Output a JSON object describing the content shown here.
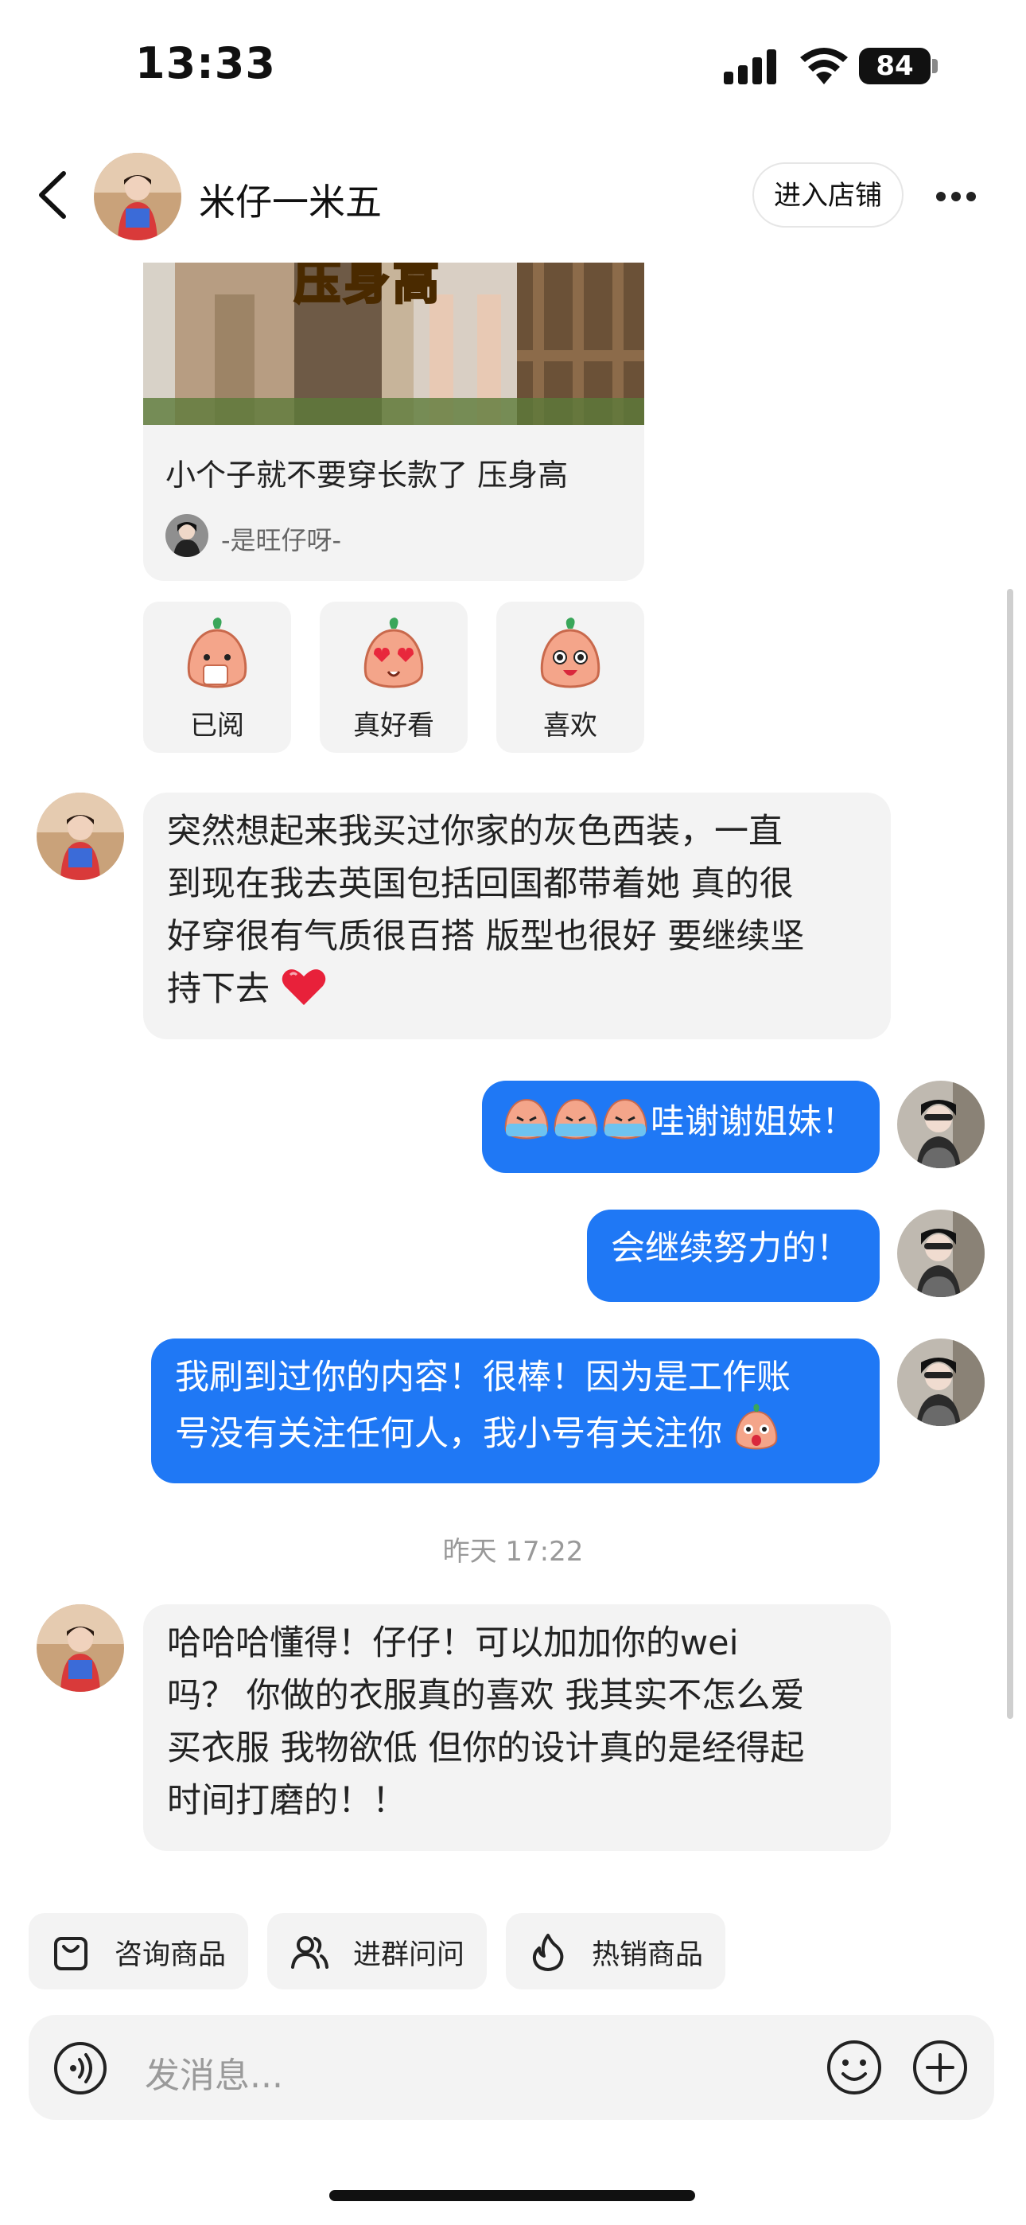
{
  "status_bar": {
    "time": "13:33",
    "battery": "84"
  },
  "header": {
    "title": "米仔一米五",
    "shop_button": "进入店铺"
  },
  "card": {
    "image_text": "压身高",
    "title": "小个子就不要穿长款了 压身高",
    "author": "-是旺仔呀-"
  },
  "reactions": [
    {
      "label": "已阅",
      "icon": "read-face-icon"
    },
    {
      "label": "真好看",
      "icon": "heart-eyes-face-icon"
    },
    {
      "label": "喜欢",
      "icon": "like-face-icon"
    }
  ],
  "messages": [
    {
      "side": "left",
      "lines": [
        "突然想起来我买过你家的灰色西装，一直",
        "到现在我去英国包括回国都带着她 真的很",
        "好穿很有气质很百搭 版型也很好 要继续坚",
        "持下去"
      ],
      "emoji": "red-heart-icon"
    },
    {
      "side": "right",
      "text": "哇谢谢姐妹！",
      "emoji_prefix": "crying-face-icon"
    },
    {
      "side": "right",
      "text": "会继续努力的！"
    },
    {
      "side": "right",
      "lines": [
        "我刷到过你的内容！很棒！因为是工作账",
        "号没有关注任何人，我小号有关注你"
      ],
      "emoji": "surprised-face-icon"
    },
    {
      "side": "left",
      "lines": [
        "哈哈哈懂得！仔仔！可以加加你的wei",
        "吗？ 你做的衣服真的喜欢 我其实不怎么爱",
        "买衣服 我物欲低 但你的设计真的是经得起",
        "时间打磨的！！"
      ]
    }
  ],
  "timestamp": "昨天 17:22",
  "quick_actions": [
    {
      "label": "咨询商品",
      "icon": "shopping-bag-icon"
    },
    {
      "label": "进群问问",
      "icon": "group-icon"
    },
    {
      "label": "热销商品",
      "icon": "flame-icon"
    }
  ],
  "input": {
    "placeholder": "发消息..."
  },
  "colors": {
    "accent": "#1f78f5",
    "bubble_gray": "#f3f3f3"
  }
}
